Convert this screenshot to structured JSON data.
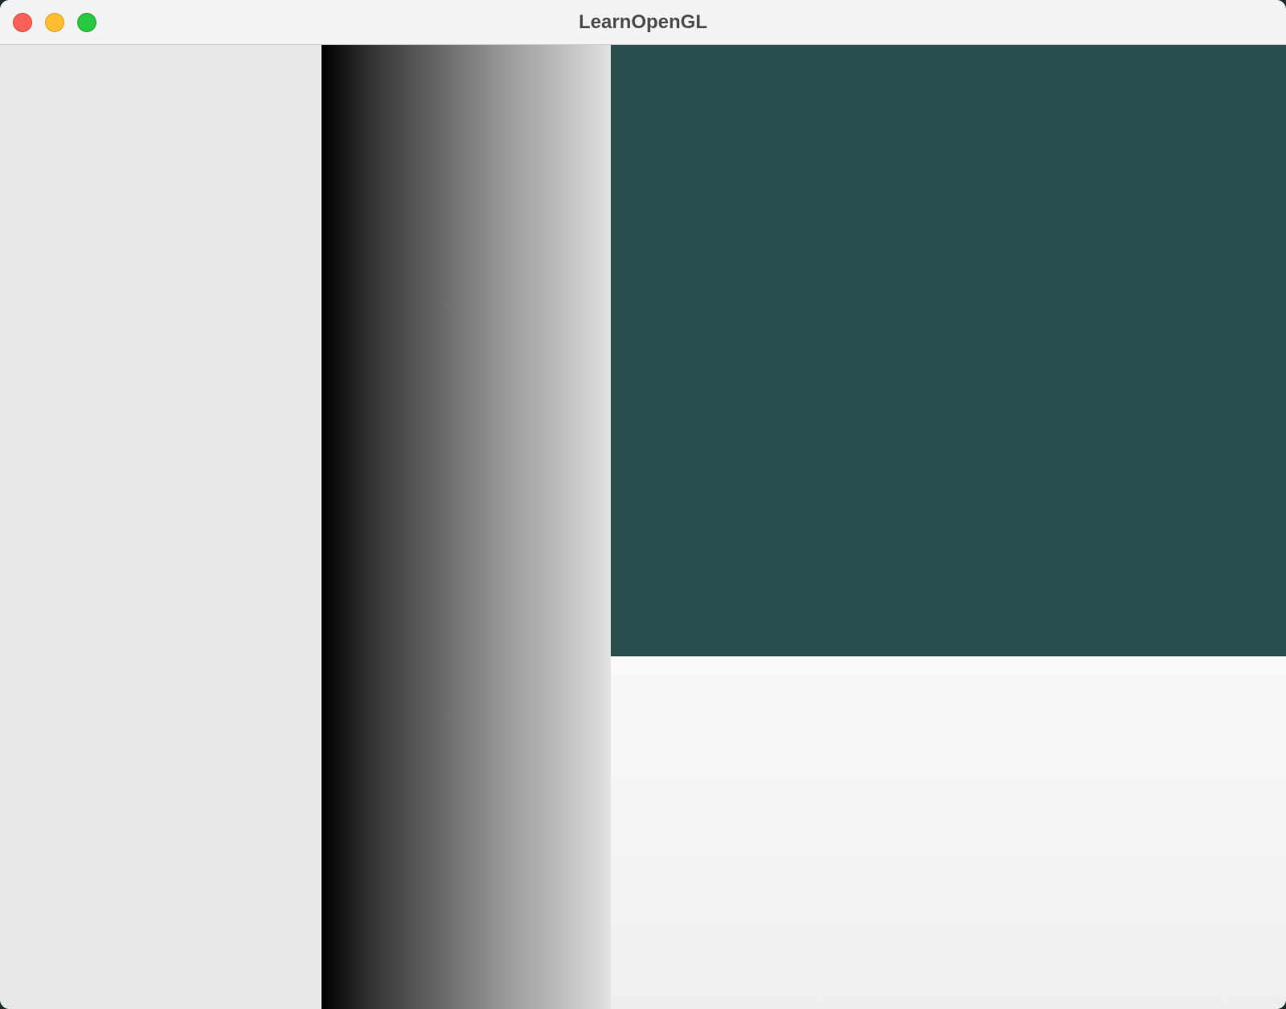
{
  "window": {
    "title": "LearnOpenGL",
    "traffic_lights": [
      {
        "name": "close-button",
        "color": "#fe5f57"
      },
      {
        "name": "minimize-button",
        "color": "#febc2e"
      },
      {
        "name": "zoom-button",
        "color": "#28c840"
      }
    ]
  },
  "viewport": {
    "panels": [
      {
        "name": "light-gray-panel",
        "color": "#e7e7e7"
      },
      {
        "name": "black-to-white-gradient-panel",
        "gradient_from": "#000000",
        "gradient_to": "#e2e2e2"
      },
      {
        "name": "dark-teal-panel",
        "color": "#2b4e4f"
      },
      {
        "name": "off-white-panel",
        "color": "#f3f3f3"
      }
    ]
  }
}
